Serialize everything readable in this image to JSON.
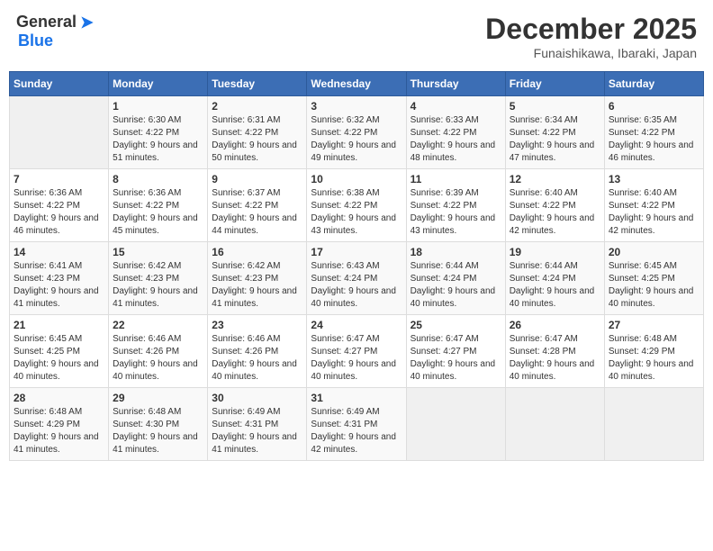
{
  "header": {
    "logo_general": "General",
    "logo_blue": "Blue",
    "month_title": "December 2025",
    "location": "Funaishikawa, Ibaraki, Japan"
  },
  "weekdays": [
    "Sunday",
    "Monday",
    "Tuesday",
    "Wednesday",
    "Thursday",
    "Friday",
    "Saturday"
  ],
  "weeks": [
    [
      {
        "day": "",
        "sunrise": "",
        "sunset": "",
        "daylight": ""
      },
      {
        "day": "1",
        "sunrise": "Sunrise: 6:30 AM",
        "sunset": "Sunset: 4:22 PM",
        "daylight": "Daylight: 9 hours and 51 minutes."
      },
      {
        "day": "2",
        "sunrise": "Sunrise: 6:31 AM",
        "sunset": "Sunset: 4:22 PM",
        "daylight": "Daylight: 9 hours and 50 minutes."
      },
      {
        "day": "3",
        "sunrise": "Sunrise: 6:32 AM",
        "sunset": "Sunset: 4:22 PM",
        "daylight": "Daylight: 9 hours and 49 minutes."
      },
      {
        "day": "4",
        "sunrise": "Sunrise: 6:33 AM",
        "sunset": "Sunset: 4:22 PM",
        "daylight": "Daylight: 9 hours and 48 minutes."
      },
      {
        "day": "5",
        "sunrise": "Sunrise: 6:34 AM",
        "sunset": "Sunset: 4:22 PM",
        "daylight": "Daylight: 9 hours and 47 minutes."
      },
      {
        "day": "6",
        "sunrise": "Sunrise: 6:35 AM",
        "sunset": "Sunset: 4:22 PM",
        "daylight": "Daylight: 9 hours and 46 minutes."
      }
    ],
    [
      {
        "day": "7",
        "sunrise": "Sunrise: 6:36 AM",
        "sunset": "Sunset: 4:22 PM",
        "daylight": "Daylight: 9 hours and 46 minutes."
      },
      {
        "day": "8",
        "sunrise": "Sunrise: 6:36 AM",
        "sunset": "Sunset: 4:22 PM",
        "daylight": "Daylight: 9 hours and 45 minutes."
      },
      {
        "day": "9",
        "sunrise": "Sunrise: 6:37 AM",
        "sunset": "Sunset: 4:22 PM",
        "daylight": "Daylight: 9 hours and 44 minutes."
      },
      {
        "day": "10",
        "sunrise": "Sunrise: 6:38 AM",
        "sunset": "Sunset: 4:22 PM",
        "daylight": "Daylight: 9 hours and 43 minutes."
      },
      {
        "day": "11",
        "sunrise": "Sunrise: 6:39 AM",
        "sunset": "Sunset: 4:22 PM",
        "daylight": "Daylight: 9 hours and 43 minutes."
      },
      {
        "day": "12",
        "sunrise": "Sunrise: 6:40 AM",
        "sunset": "Sunset: 4:22 PM",
        "daylight": "Daylight: 9 hours and 42 minutes."
      },
      {
        "day": "13",
        "sunrise": "Sunrise: 6:40 AM",
        "sunset": "Sunset: 4:22 PM",
        "daylight": "Daylight: 9 hours and 42 minutes."
      }
    ],
    [
      {
        "day": "14",
        "sunrise": "Sunrise: 6:41 AM",
        "sunset": "Sunset: 4:23 PM",
        "daylight": "Daylight: 9 hours and 41 minutes."
      },
      {
        "day": "15",
        "sunrise": "Sunrise: 6:42 AM",
        "sunset": "Sunset: 4:23 PM",
        "daylight": "Daylight: 9 hours and 41 minutes."
      },
      {
        "day": "16",
        "sunrise": "Sunrise: 6:42 AM",
        "sunset": "Sunset: 4:23 PM",
        "daylight": "Daylight: 9 hours and 41 minutes."
      },
      {
        "day": "17",
        "sunrise": "Sunrise: 6:43 AM",
        "sunset": "Sunset: 4:24 PM",
        "daylight": "Daylight: 9 hours and 40 minutes."
      },
      {
        "day": "18",
        "sunrise": "Sunrise: 6:44 AM",
        "sunset": "Sunset: 4:24 PM",
        "daylight": "Daylight: 9 hours and 40 minutes."
      },
      {
        "day": "19",
        "sunrise": "Sunrise: 6:44 AM",
        "sunset": "Sunset: 4:24 PM",
        "daylight": "Daylight: 9 hours and 40 minutes."
      },
      {
        "day": "20",
        "sunrise": "Sunrise: 6:45 AM",
        "sunset": "Sunset: 4:25 PM",
        "daylight": "Daylight: 9 hours and 40 minutes."
      }
    ],
    [
      {
        "day": "21",
        "sunrise": "Sunrise: 6:45 AM",
        "sunset": "Sunset: 4:25 PM",
        "daylight": "Daylight: 9 hours and 40 minutes."
      },
      {
        "day": "22",
        "sunrise": "Sunrise: 6:46 AM",
        "sunset": "Sunset: 4:26 PM",
        "daylight": "Daylight: 9 hours and 40 minutes."
      },
      {
        "day": "23",
        "sunrise": "Sunrise: 6:46 AM",
        "sunset": "Sunset: 4:26 PM",
        "daylight": "Daylight: 9 hours and 40 minutes."
      },
      {
        "day": "24",
        "sunrise": "Sunrise: 6:47 AM",
        "sunset": "Sunset: 4:27 PM",
        "daylight": "Daylight: 9 hours and 40 minutes."
      },
      {
        "day": "25",
        "sunrise": "Sunrise: 6:47 AM",
        "sunset": "Sunset: 4:27 PM",
        "daylight": "Daylight: 9 hours and 40 minutes."
      },
      {
        "day": "26",
        "sunrise": "Sunrise: 6:47 AM",
        "sunset": "Sunset: 4:28 PM",
        "daylight": "Daylight: 9 hours and 40 minutes."
      },
      {
        "day": "27",
        "sunrise": "Sunrise: 6:48 AM",
        "sunset": "Sunset: 4:29 PM",
        "daylight": "Daylight: 9 hours and 40 minutes."
      }
    ],
    [
      {
        "day": "28",
        "sunrise": "Sunrise: 6:48 AM",
        "sunset": "Sunset: 4:29 PM",
        "daylight": "Daylight: 9 hours and 41 minutes."
      },
      {
        "day": "29",
        "sunrise": "Sunrise: 6:48 AM",
        "sunset": "Sunset: 4:30 PM",
        "daylight": "Daylight: 9 hours and 41 minutes."
      },
      {
        "day": "30",
        "sunrise": "Sunrise: 6:49 AM",
        "sunset": "Sunset: 4:31 PM",
        "daylight": "Daylight: 9 hours and 41 minutes."
      },
      {
        "day": "31",
        "sunrise": "Sunrise: 6:49 AM",
        "sunset": "Sunset: 4:31 PM",
        "daylight": "Daylight: 9 hours and 42 minutes."
      },
      {
        "day": "",
        "sunrise": "",
        "sunset": "",
        "daylight": ""
      },
      {
        "day": "",
        "sunrise": "",
        "sunset": "",
        "daylight": ""
      },
      {
        "day": "",
        "sunrise": "",
        "sunset": "",
        "daylight": ""
      }
    ]
  ]
}
